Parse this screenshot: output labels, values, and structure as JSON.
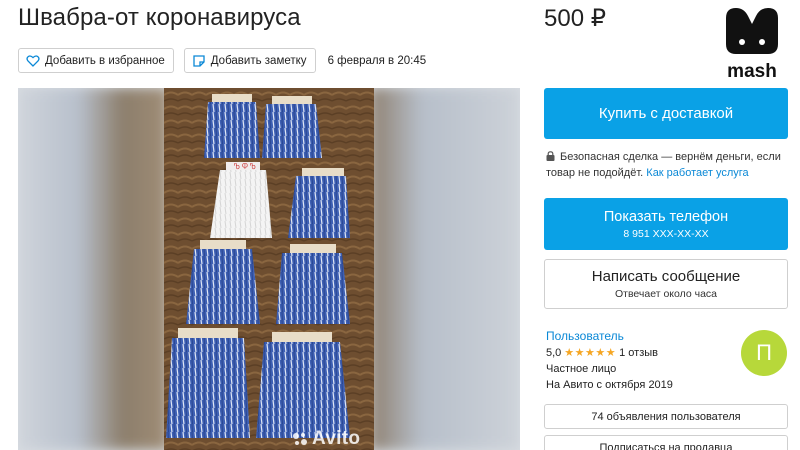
{
  "listing": {
    "title": "Швабра-от коронавируса",
    "price": "500 ₽",
    "date": "6 февраля в 20:45"
  },
  "toolbar": {
    "favorite_label": "Добавить в избранное",
    "note_label": "Добавить заметку"
  },
  "gallery": {
    "watermark": "Avito"
  },
  "actions": {
    "buy_label": "Купить с доставкой",
    "safe_text": "Безопасная сделка — вернём деньги, если товар не подойдёт.",
    "safe_link": "Как работает услуга",
    "phone_label": "Показать телефон",
    "phone_number": "8 951 XXX-XX-XX",
    "message_label": "Написать сообщение",
    "message_sub": "Отвечает около часа"
  },
  "seller": {
    "name": "Пользователь",
    "rating": "5,0",
    "stars": "★★★★★",
    "reviews": "1 отзыв",
    "type": "Частное лицо",
    "since": "На Авито с октября 2019",
    "avatar_letter": "П",
    "ads_label": "74 объявления пользователя",
    "subscribe_label": "Подписаться на продавца"
  },
  "logo": {
    "text": "mash"
  },
  "colors": {
    "accent": "#0aa1e6",
    "link": "#0a88d6",
    "star": "#f5a623",
    "avatar": "#b7d83a"
  },
  "icons": [
    "heart-icon",
    "note-icon",
    "lock-icon",
    "avito-dots-icon",
    "mash-logo"
  ]
}
